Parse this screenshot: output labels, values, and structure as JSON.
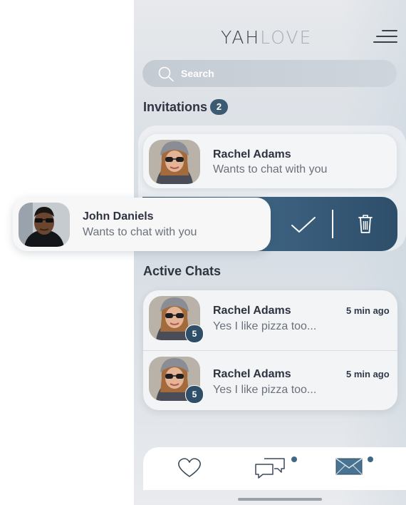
{
  "app": {
    "logo_part1": "YAH",
    "logo_part2": "LOVE"
  },
  "search": {
    "placeholder": "Search"
  },
  "invitations": {
    "title": "Invitations",
    "count": "2",
    "items": [
      {
        "name": "Rachel Adams",
        "message": "Wants to chat with you"
      },
      {
        "name": "John Daniels",
        "message": "Wants to chat with you"
      }
    ]
  },
  "active_chats": {
    "title": "Active Chats",
    "items": [
      {
        "name": "Rachel Adams",
        "message": "Yes I like pizza too...",
        "time": "5 min ago",
        "unread": "5"
      },
      {
        "name": "Rachel Adams",
        "message": "Yes I like pizza too...",
        "time": "5 min ago",
        "unread": "5"
      }
    ]
  },
  "icons": {
    "menu": "menu-icon",
    "search": "search-icon",
    "accept": "check-icon",
    "delete": "trash-icon",
    "tab_likes": "heart-icon",
    "tab_chats": "chat-bubbles-icon",
    "tab_messages": "envelope-icon"
  },
  "colors": {
    "accent": "#3d5a73",
    "swipe": "#2e4d67"
  }
}
